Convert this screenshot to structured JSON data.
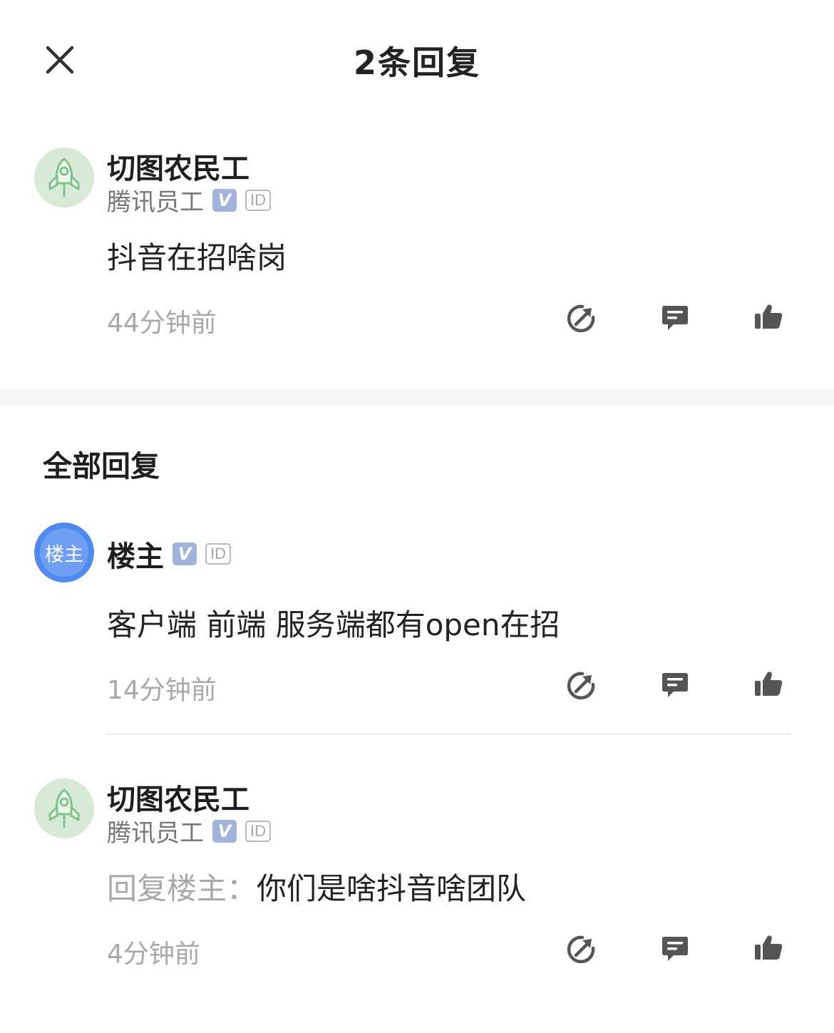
{
  "header": {
    "title": "2条回复"
  },
  "main_comment": {
    "author": "切图农民工",
    "subtitle": "腾讯员工",
    "verified_badge": "V",
    "id_badge": "ID",
    "content": "抖音在招啥岗",
    "time": "44分钟前"
  },
  "section": {
    "title": "全部回复"
  },
  "replies": [
    {
      "avatar_text": "楼主",
      "author": "楼主",
      "verified_badge": "V",
      "id_badge": "ID",
      "content": "客户端 前端 服务端都有open在招",
      "time": "14分钟前"
    },
    {
      "author": "切图农民工",
      "subtitle": "腾讯员工",
      "verified_badge": "V",
      "id_badge": "ID",
      "reply_prefix": "回复楼主：",
      "content": "你们是啥抖音啥团队",
      "time": "4分钟前"
    }
  ],
  "icons": {
    "close": "close-icon",
    "share": "share-icon",
    "comment": "comment-icon",
    "like": "thumbs-up-icon",
    "avatar_default": "rocket-icon"
  },
  "colors": {
    "icon_gray": "#555555",
    "secondary_text": "#a8a8a8",
    "avatar_green": "#d7ead5",
    "avatar_blue": "#4f8af0",
    "badge_v": "#a3b2da"
  }
}
